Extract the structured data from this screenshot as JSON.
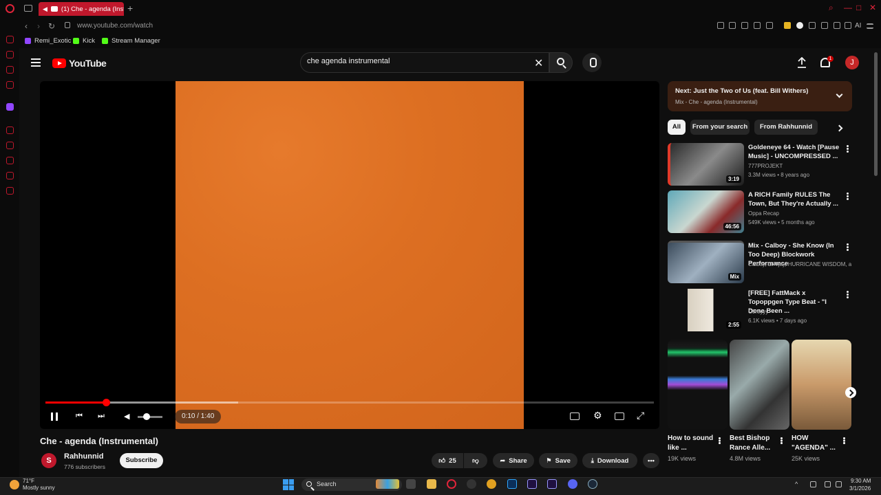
{
  "browser": {
    "tab_title": "(1) Che - agenda (Instru",
    "url": "www.youtube.com/watch",
    "ai_label": "AI",
    "bookmarks": [
      "Remi_Exotic",
      "Kick",
      "Stream Manager"
    ]
  },
  "header": {
    "logo_text": "YouTube",
    "search_value": "che agenda instrumental",
    "notifications_count": "1",
    "avatar_initial": "J"
  },
  "player": {
    "time_display": "0:10 / 1:40",
    "progress_fraction": 0.1,
    "volume_fraction": 0.35,
    "cover_color": "#de7027"
  },
  "video": {
    "title": "Che - agenda (Instrumental)",
    "channel_initial": "S",
    "channel_name": "Rahhunnid",
    "subscribers": "776 subscribers",
    "subscribe_label": "Subscribe",
    "likes": "25",
    "share_label": "Share",
    "save_label": "Save",
    "download_label": "Download"
  },
  "up_next": {
    "title": "Next: Just the Two of Us (feat. Bill Withers)",
    "subtitle": "Mix - Che - agenda (Instrumental)"
  },
  "chips": [
    "All",
    "From your search",
    "From Rahhunnid"
  ],
  "recommendations": [
    {
      "title": "Goldeneye 64 - Watch [Pause Music] - UNCOMPRESSED ...",
      "channel": "777PROJEKT",
      "meta": "3.3M views • 8 years ago",
      "badge": "3:19"
    },
    {
      "title": "A RICH Family RULES The Town, But They're Actually ...",
      "channel": "Oppa Recap",
      "meta": "549K views • 5 months ago",
      "badge": "46:56"
    },
    {
      "title": "Mix - Calboy - She Know (In Too Deep) Blockwork Performance",
      "channel": "Calboy, Lil Tjay, HURRICANE WISDOM, a...",
      "meta": "",
      "badge": "Mix"
    },
    {
      "title": "[FREE] FattMack x Topoppgen Type Beat - \"I Done Been ...",
      "channel": "C0reyyy",
      "meta": "6.1K views • 7 days ago",
      "badge": "2:55"
    }
  ],
  "shorts": [
    {
      "title": "How to sound like ...",
      "views": "19K views"
    },
    {
      "title": "Best Bishop Rance Alle...",
      "views": "4.8M views"
    },
    {
      "title": "HOW \"AGENDA\" ...",
      "views": "25K views"
    }
  ],
  "taskbar": {
    "temp": "71°F",
    "weather": "Mostly sunny",
    "search_label": "Search",
    "time": "9:30 AM",
    "date": "3/1/2026"
  }
}
